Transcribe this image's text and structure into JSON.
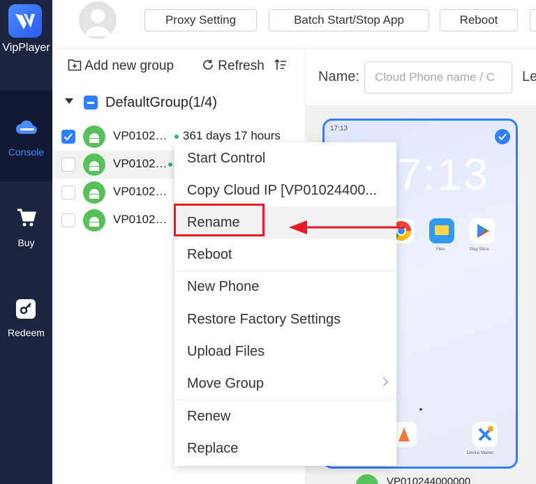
{
  "app": {
    "name": "VipPlayer"
  },
  "sidebar": {
    "items": [
      {
        "label": "Console",
        "icon": "cloud-icon",
        "active": true
      },
      {
        "label": "Buy",
        "icon": "cart-icon",
        "active": false
      },
      {
        "label": "Redeem",
        "icon": "key-icon",
        "active": false
      }
    ]
  },
  "topbar": {
    "buttons": [
      "Proxy Setting",
      "Batch Start/Stop App",
      "Reboot"
    ]
  },
  "groups_panel": {
    "add_group_label": "Add new group",
    "refresh_label": "Refresh",
    "group": {
      "label": "DefaultGroup(1/4)"
    },
    "phones": [
      {
        "name": "VP0102…",
        "checked": true,
        "expiry": "361 days 17 hours"
      },
      {
        "name": "VP0102…",
        "checked": false
      },
      {
        "name": "VP0102…",
        "checked": false
      },
      {
        "name": "VP0102…",
        "checked": false
      }
    ]
  },
  "filters": {
    "name_label": "Name:",
    "name_placeholder": "Cloud Phone name / C",
    "next_label": "Le"
  },
  "preview": {
    "status_time": "17:13",
    "clock": "17:13",
    "apps": [
      "Files",
      "Play Store",
      "Device Master"
    ],
    "card_name": "VP010244000000"
  },
  "context_menu": {
    "items": [
      "Start Control",
      "Copy Cloud IP [VP01024400...",
      "Rename",
      "Reboot",
      "New Phone",
      "Restore Factory Settings",
      "Upload Files",
      "Move Group",
      "Renew",
      "Replace"
    ],
    "highlighted": "Rename"
  },
  "colors": {
    "sidebar_bg": "#1c2540",
    "accent": "#2f7fff",
    "callout": "#e51c23",
    "android_green": "#58c05a"
  }
}
